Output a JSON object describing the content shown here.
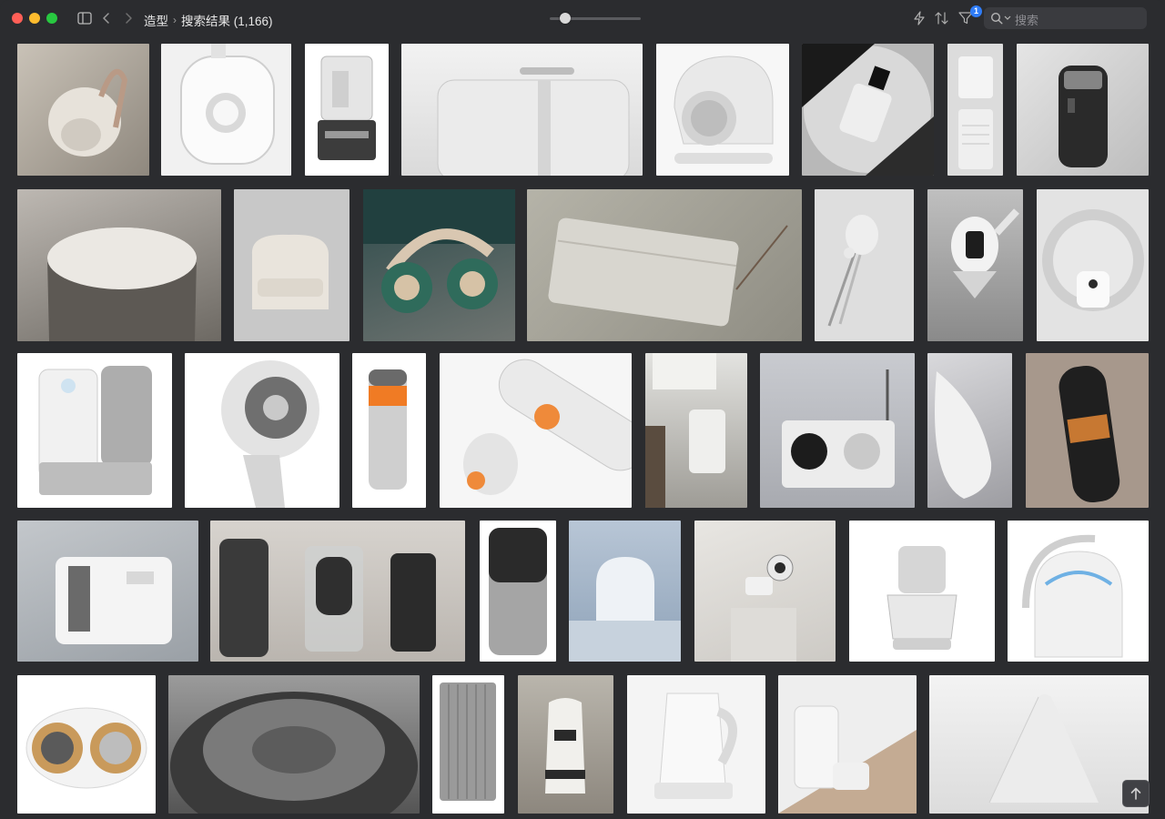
{
  "window": {
    "title": "造型 › 搜索结果 (1,166)"
  },
  "breadcrumb": {
    "folder": "造型",
    "separator": "›",
    "result": "搜索结果 (1,166)"
  },
  "toolbar": {
    "thumbnail_size": 0.15,
    "filter_badge": "1",
    "search": {
      "value": "",
      "placeholder": "搜索"
    },
    "icons": [
      "sidebar-toggle-icon",
      "back-chevron-icon",
      "forward-chevron-icon",
      "lightning-icon",
      "sort-icon",
      "filter-icon",
      "search-icon"
    ]
  },
  "grid": {
    "rows": [
      [
        "speaker-with-strap",
        "donut-appliance",
        "food-processor",
        "white-suitcase",
        "desk-fan-white",
        "perfume-bottle",
        "cylinder-purifier",
        "black-shaver"
      ],
      [
        "round-diffuser",
        "lounge-chair",
        "green-headphones",
        "white-case-pouch",
        "scissors-bulb",
        "robot-head",
        "round-dome-device"
      ],
      [
        "air-purifier-tank",
        "hair-dryer",
        "travel-mug",
        "capsule-grinder",
        "room-heater",
        "braun-radio-clock",
        "white-sculpted-device",
        "dark-tumbler"
      ],
      [
        "humidifier-display",
        "glass-coffee-machines",
        "phone-speaker",
        "smart-speaker-blue",
        "security-camera",
        "glass-blender",
        "arc-humidifier"
      ],
      [
        "gold-speaker",
        "round-speaker-top",
        "slim-radiator",
        "service-robot",
        "white-kettle",
        "coffee-maker",
        "cone-lamp"
      ]
    ]
  }
}
